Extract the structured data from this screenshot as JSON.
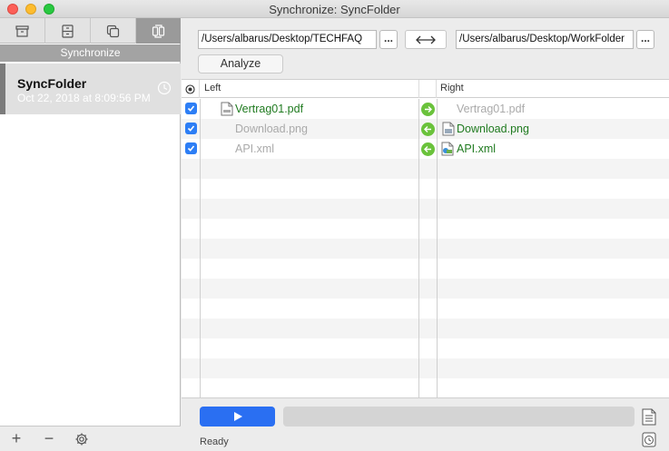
{
  "window": {
    "title": "Synchronize: SyncFolder"
  },
  "sidebar": {
    "tabs": [
      {
        "icon": "archive-icon"
      },
      {
        "icon": "drawer-icon"
      },
      {
        "icon": "copy-icon"
      },
      {
        "icon": "sync-icon",
        "active": true
      }
    ],
    "caption": "Synchronize",
    "item": {
      "name": "SyncFolder",
      "date": "Oct 22, 2018 at 8:09:56 PM"
    },
    "bottom": {
      "add": "+",
      "remove": "−"
    }
  },
  "toolbar": {
    "left_path": "/Users/albarus/Desktop/TECHFAQ",
    "right_path": "/Users/albarus/Desktop/WorkFolder",
    "browse_label": "...",
    "analyze_label": "Analyze"
  },
  "table": {
    "columns": {
      "left": "Left",
      "right": "Right"
    },
    "rows": [
      {
        "left": "Vertrag01.pdf",
        "left_state": "new",
        "right": "Vertrag01.pdf",
        "right_state": "missing",
        "direction": "right"
      },
      {
        "left": "Download.png",
        "left_state": "missing",
        "right": "Download.png",
        "right_state": "new",
        "direction": "left"
      },
      {
        "left": "API.xml",
        "left_state": "missing",
        "right": "API.xml",
        "right_state": "new",
        "direction": "left"
      }
    ]
  },
  "status": {
    "text": "Ready"
  },
  "colors": {
    "accent": "#2a6ff2",
    "new_file": "#1f7a1f",
    "arrow": "#6ac23b"
  }
}
